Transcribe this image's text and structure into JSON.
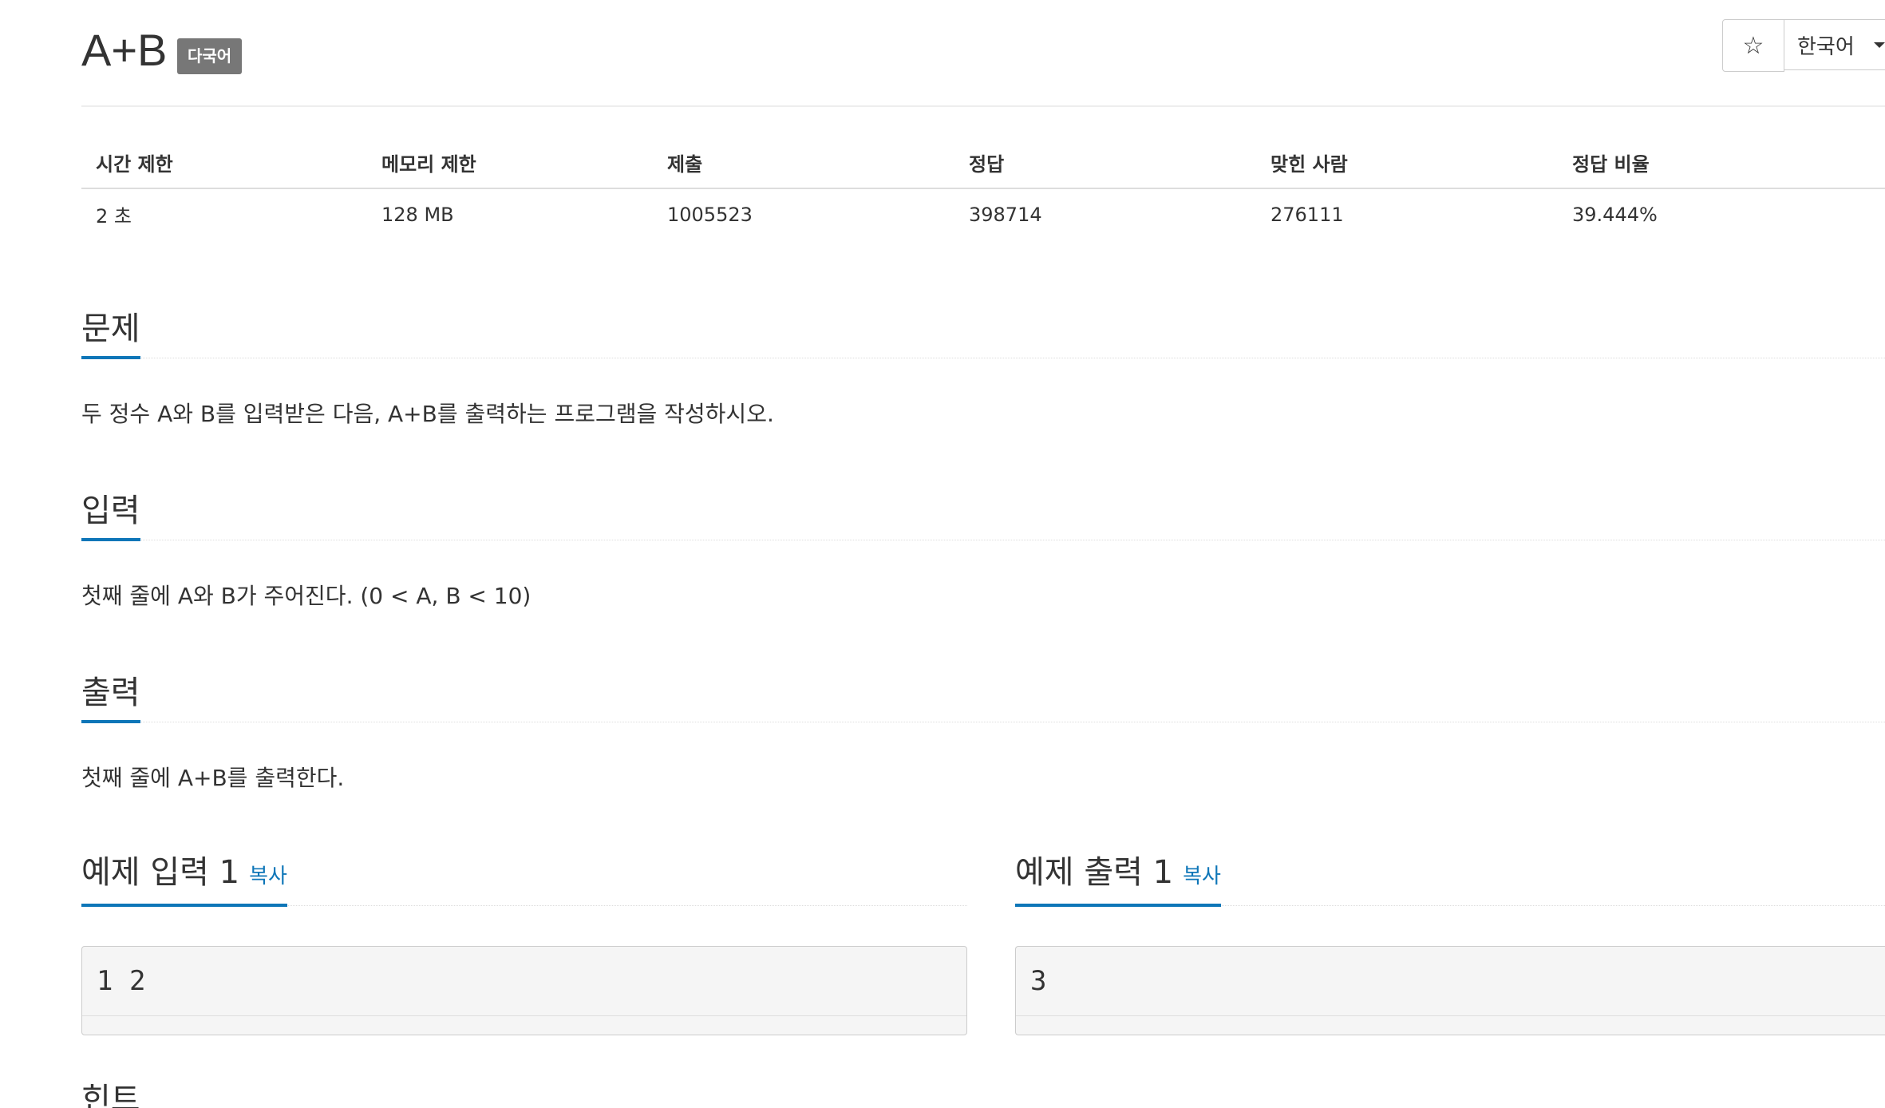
{
  "problem": {
    "title": "A+B",
    "badge": "다국어"
  },
  "toolbar": {
    "star_icon": "star-icon",
    "language": "한국어"
  },
  "info_table": {
    "headers": [
      "시간 제한",
      "메모리 제한",
      "제출",
      "정답",
      "맞힌 사람",
      "정답 비율"
    ],
    "values": [
      "2 초",
      "128 MB",
      "1005523",
      "398714",
      "276111",
      "39.444%"
    ]
  },
  "sections": {
    "problem": {
      "title": "문제",
      "text": "두 정수 A와 B를 입력받은 다음, A+B를 출력하는 프로그램을 작성하시오."
    },
    "input": {
      "title": "입력",
      "text": "첫째 줄에 A와 B가 주어진다. (0 < A, B < 10)"
    },
    "output": {
      "title": "출력",
      "text": "첫째 줄에 A+B를 출력한다."
    },
    "hint": {
      "title": "힌트"
    }
  },
  "samples": {
    "input": {
      "title": "예제 입력 1",
      "copy_label": "복사",
      "value": "1 2"
    },
    "output": {
      "title": "예제 출력 1",
      "copy_label": "복사",
      "value": "3"
    }
  },
  "colors": {
    "accent": "#0e76b8",
    "badge": "#777777"
  }
}
